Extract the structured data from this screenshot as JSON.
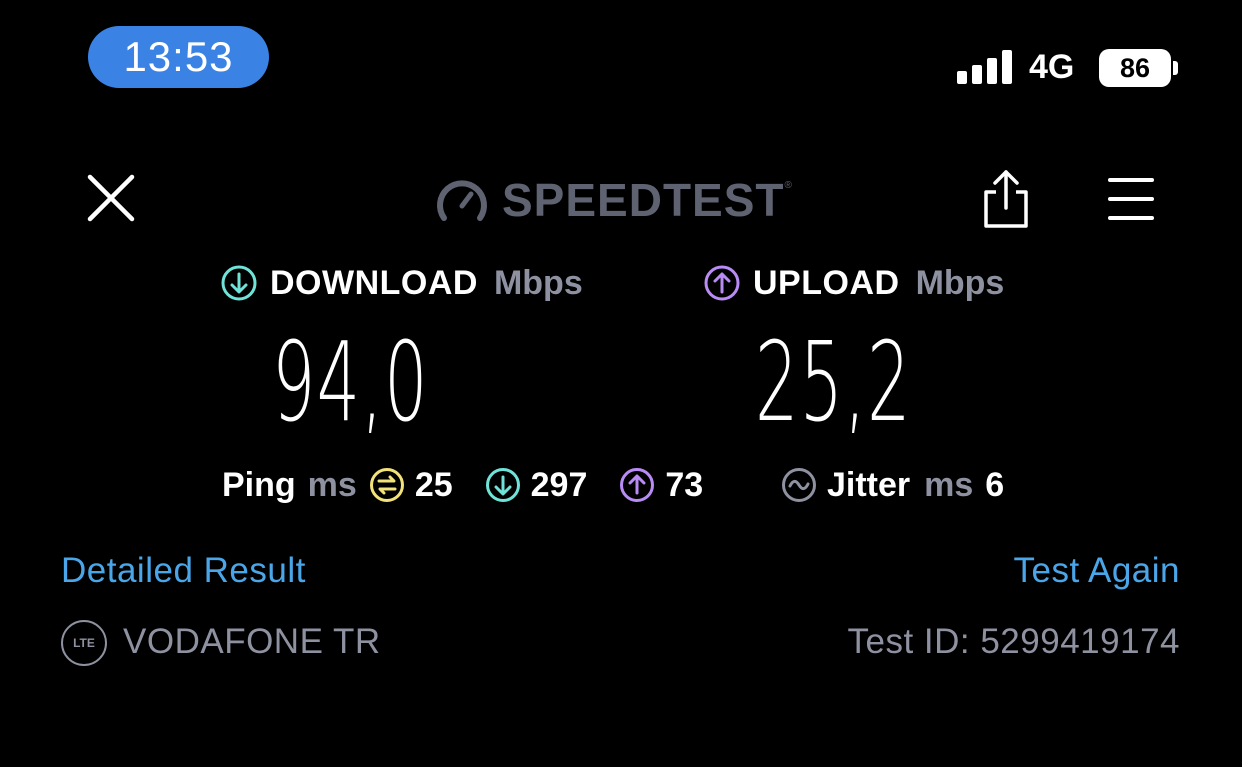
{
  "status_bar": {
    "time": "13:53",
    "network": "4G",
    "battery": "86"
  },
  "header": {
    "brand": "SPEEDTEST",
    "brand_mark": "®",
    "close_icon": "close-icon",
    "share_icon": "share-icon",
    "menu_icon": "hamburger-menu-icon"
  },
  "download": {
    "label": "DOWNLOAD",
    "unit": "Mbps",
    "value": "94,0",
    "icon_color": "#6fe3d8"
  },
  "upload": {
    "label": "UPLOAD",
    "unit": "Mbps",
    "value": "25,2",
    "icon_color": "#b98cf5"
  },
  "ping": {
    "label": "Ping",
    "unit": "ms",
    "idle": "25",
    "idle_color": "#f2e27a",
    "download": "297",
    "upload": "73"
  },
  "jitter": {
    "label": "Jitter",
    "unit": "ms",
    "value": "6"
  },
  "links": {
    "detailed": "Detailed Result",
    "again": "Test Again"
  },
  "footer": {
    "badge": "LTE",
    "provider": "VODAFONE TR",
    "test_id": "Test ID: 5299419174"
  },
  "colors": {
    "accent_link": "#4aa6e8",
    "muted": "#8e91a0",
    "time_pill": "#3a82e4"
  }
}
